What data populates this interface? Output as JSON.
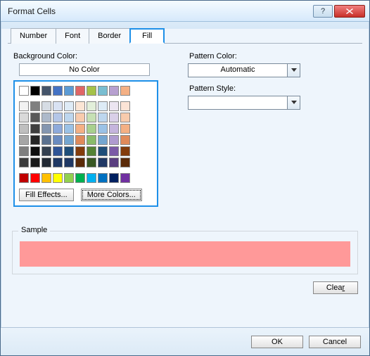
{
  "window": {
    "title": "Format Cells"
  },
  "tabs": {
    "number": "Number",
    "font": "Font",
    "border": "Border",
    "fill": "Fill"
  },
  "labels": {
    "background_color": "Background Color:",
    "pattern_color": "Pattern Color:",
    "pattern_style": "Pattern Style:",
    "no_color": "No Color",
    "fill_effects": "Fill Effects...",
    "more_colors": "More Colors...",
    "sample": "Sample",
    "clear_prefix": "Clea",
    "clear_key": "r",
    "ok": "OK",
    "cancel": "Cancel"
  },
  "pattern_color": {
    "value": "Automatic"
  },
  "pattern_style": {
    "value": ""
  },
  "sample_color": "#ff9999",
  "palette": {
    "row_theme": [
      "#ffffff",
      "#000000",
      "#44546a",
      "#4472c4",
      "#5b9bd5",
      "#e06666",
      "#a5c249",
      "#7abed1",
      "#b7a0d0",
      "#f4b084"
    ],
    "row_tint1": [
      "#f2f2f2",
      "#808080",
      "#d6dce4",
      "#d9e2f3",
      "#deebf6",
      "#fbe5d5",
      "#e2efda",
      "#ddebf6",
      "#ece5f1",
      "#fce4d6"
    ],
    "row_tint2": [
      "#d9d9d9",
      "#595959",
      "#adb9ca",
      "#b4c6e7",
      "#bdd6ee",
      "#f8cbad",
      "#c6e0b4",
      "#bdd6ee",
      "#d9cfe8",
      "#f8cbad"
    ],
    "row_tint3": [
      "#bfbfbf",
      "#404040",
      "#8496b0",
      "#8eaadb",
      "#9bc2e6",
      "#f4b084",
      "#a9d08e",
      "#9bc2e6",
      "#c5b5dd",
      "#f4b084"
    ],
    "row_tint4": [
      "#a6a6a6",
      "#262626",
      "#5b718f",
      "#6a8bc0",
      "#74a6d0",
      "#e08a5a",
      "#89bb6a",
      "#74a6d0",
      "#af9bcf",
      "#e08a5a"
    ],
    "row_tint5": [
      "#7f7f7f",
      "#0d0d0d",
      "#333f4f",
      "#2f5496",
      "#1f4e79",
      "#833c0c",
      "#548235",
      "#1f4e79",
      "#7b5aa6",
      "#833c0c"
    ],
    "row_dark": [
      "#3b3b3b",
      "#1a1a1a",
      "#222933",
      "#1f3864",
      "#203864",
      "#5a2a08",
      "#385723",
      "#203864",
      "#5a3e80",
      "#5a2a08"
    ],
    "row_standard": [
      "#c00000",
      "#ff0000",
      "#ffc000",
      "#ffff00",
      "#92d050",
      "#00b050",
      "#00b0f0",
      "#0070c0",
      "#002060",
      "#7030a0"
    ]
  }
}
